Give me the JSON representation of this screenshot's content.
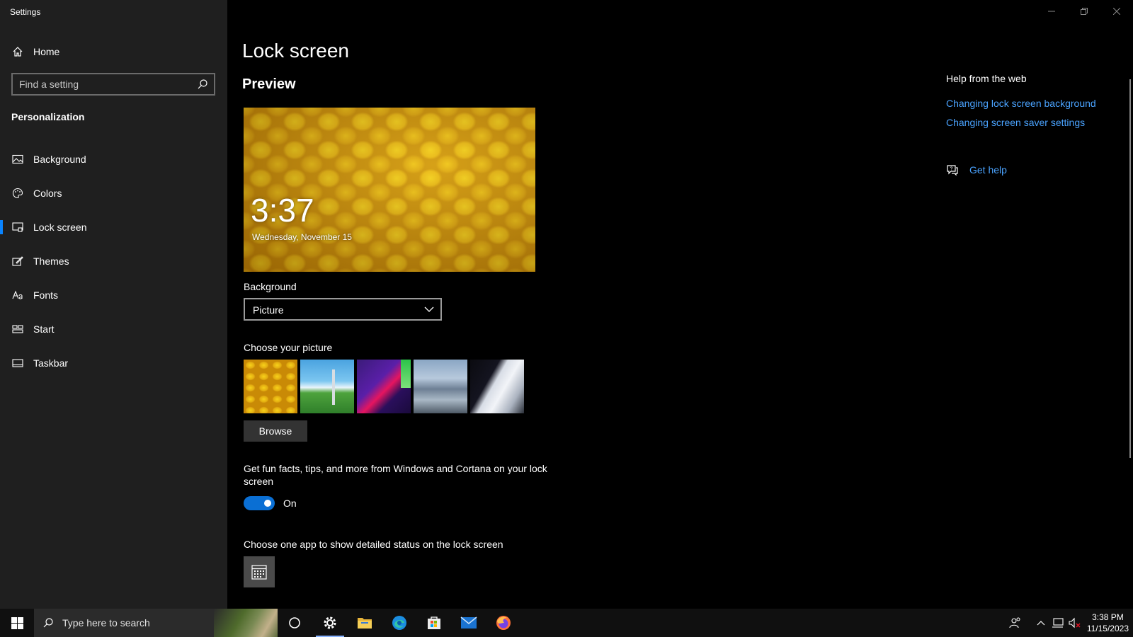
{
  "window": {
    "app_title": "Settings"
  },
  "sidebar": {
    "home_label": "Home",
    "search_placeholder": "Find a setting",
    "section_title": "Personalization",
    "items": [
      {
        "label": "Background",
        "icon": "picture-icon",
        "active": false
      },
      {
        "label": "Colors",
        "icon": "palette-icon",
        "active": false
      },
      {
        "label": "Lock screen",
        "icon": "lock-screen-icon",
        "active": true
      },
      {
        "label": "Themes",
        "icon": "brush-icon",
        "active": false
      },
      {
        "label": "Fonts",
        "icon": "font-icon",
        "active": false
      },
      {
        "label": "Start",
        "icon": "start-icon",
        "active": false
      },
      {
        "label": "Taskbar",
        "icon": "taskbar-icon",
        "active": false
      }
    ]
  },
  "main": {
    "title": "Lock screen",
    "preview_heading": "Preview",
    "preview_time": "3:37",
    "preview_date": "Wednesday, November 15",
    "background_label": "Background",
    "background_value": "Picture",
    "choose_picture_label": "Choose your picture",
    "browse_label": "Browse",
    "fun_facts_label": "Get fun facts, tips, and more from Windows and Cortana on your lock screen",
    "toggle_state": "On",
    "toggle_on": true,
    "app_status_label": "Choose one app to show detailed status on the lock screen",
    "app_status_icon": "calendar-icon"
  },
  "help": {
    "title": "Help from the web",
    "links": [
      "Changing lock screen background",
      "Changing screen saver settings"
    ],
    "get_help": "Get help"
  },
  "taskbar": {
    "search_placeholder": "Type here to search",
    "apps": [
      "cortana-icon",
      "settings-icon",
      "file-explorer-icon",
      "edge-icon",
      "store-icon",
      "mail-icon",
      "firefox-icon"
    ],
    "clock_time": "3:38 PM",
    "clock_date": "11/15/2023"
  },
  "colors": {
    "accent": "#0a84ff",
    "link": "#4aa3ff",
    "sidebar_bg": "#1f1f1f"
  }
}
